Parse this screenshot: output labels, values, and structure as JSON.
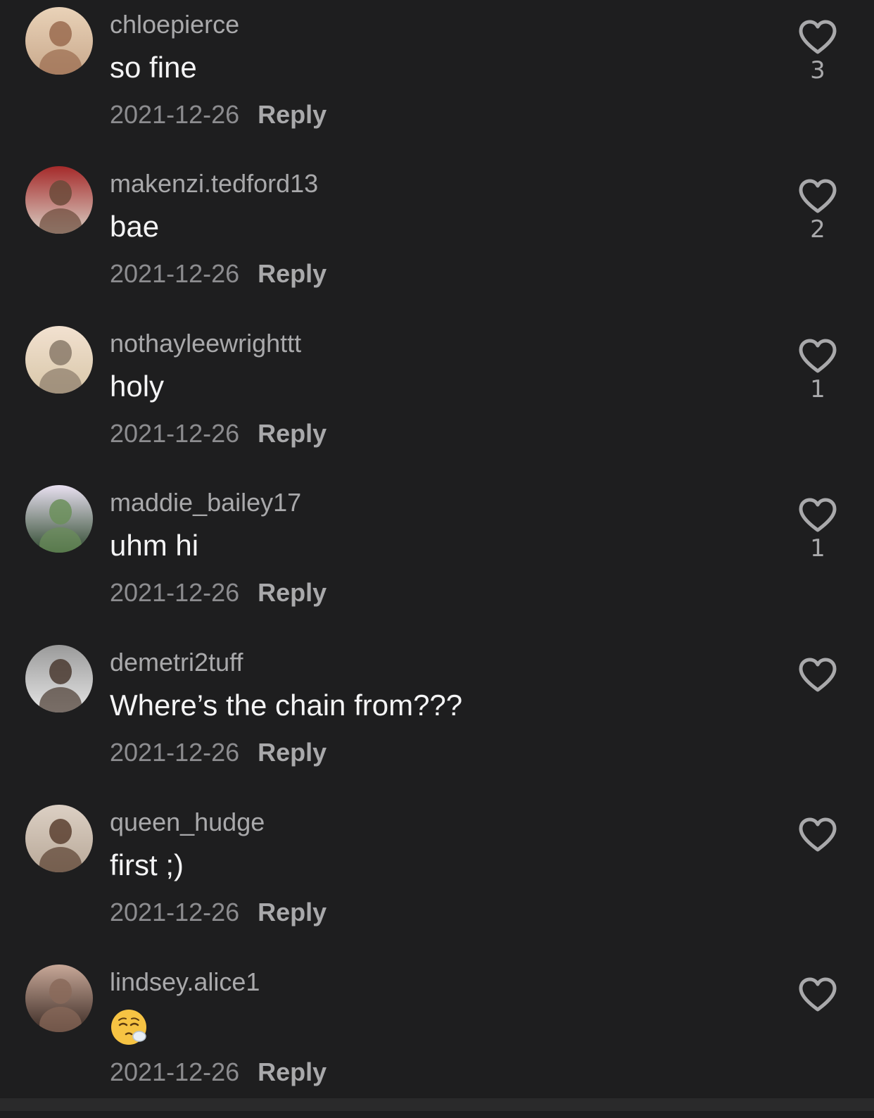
{
  "comments": [
    {
      "username": "chloepierce",
      "text": "so fine",
      "date": "2021-12-26",
      "reply": "Reply",
      "likes": "3",
      "avatar_colors": [
        "#c9a98c",
        "#9a6b4f",
        "#e9d2b8"
      ]
    },
    {
      "username": "makenzi.tedford13",
      "text": "bae",
      "date": "2021-12-26",
      "reply": "Reply",
      "likes": "2",
      "avatar_colors": [
        "#d9cfc4",
        "#6b4a3a",
        "#a52a2a"
      ]
    },
    {
      "username": "nothayleewrighttt",
      "text": "holy",
      "date": "2021-12-26",
      "reply": "Reply",
      "likes": "1",
      "avatar_colors": [
        "#d8c7a9",
        "#8a7a6a",
        "#f2e1d0"
      ]
    },
    {
      "username": "maddie_bailey17",
      "text": "uhm hi",
      "date": "2021-12-26",
      "reply": "Reply",
      "likes": "1",
      "avatar_colors": [
        "#2f4a2f",
        "#6b8f5a",
        "#e8e0f0"
      ]
    },
    {
      "username": "demetri2tuff",
      "text": "Where’s the chain from???",
      "date": "2021-12-26",
      "reply": "Reply",
      "likes": "",
      "avatar_colors": [
        "#e6e6e6",
        "#4a3a30",
        "#9a9a9a"
      ]
    },
    {
      "username": "queen_hudge",
      "text": "first ;)",
      "date": "2021-12-26",
      "reply": "Reply",
      "likes": "",
      "avatar_colors": [
        "#b8a898",
        "#5a4030",
        "#dcd0c4"
      ]
    },
    {
      "username": "lindsey.alice1",
      "text": "",
      "emoji": "relieved-face-emoji",
      "date": "2021-12-26",
      "reply": "Reply",
      "likes": "",
      "avatar_colors": [
        "#3a2a24",
        "#8a6a5a",
        "#c8a898"
      ]
    }
  ],
  "theme": {
    "background": "#1e1e1f",
    "username_color": "#a9a9ab",
    "text_color": "#f4f4f5",
    "date_color": "#8c8c8f"
  },
  "icons": {
    "like": "heart-outline-icon"
  }
}
